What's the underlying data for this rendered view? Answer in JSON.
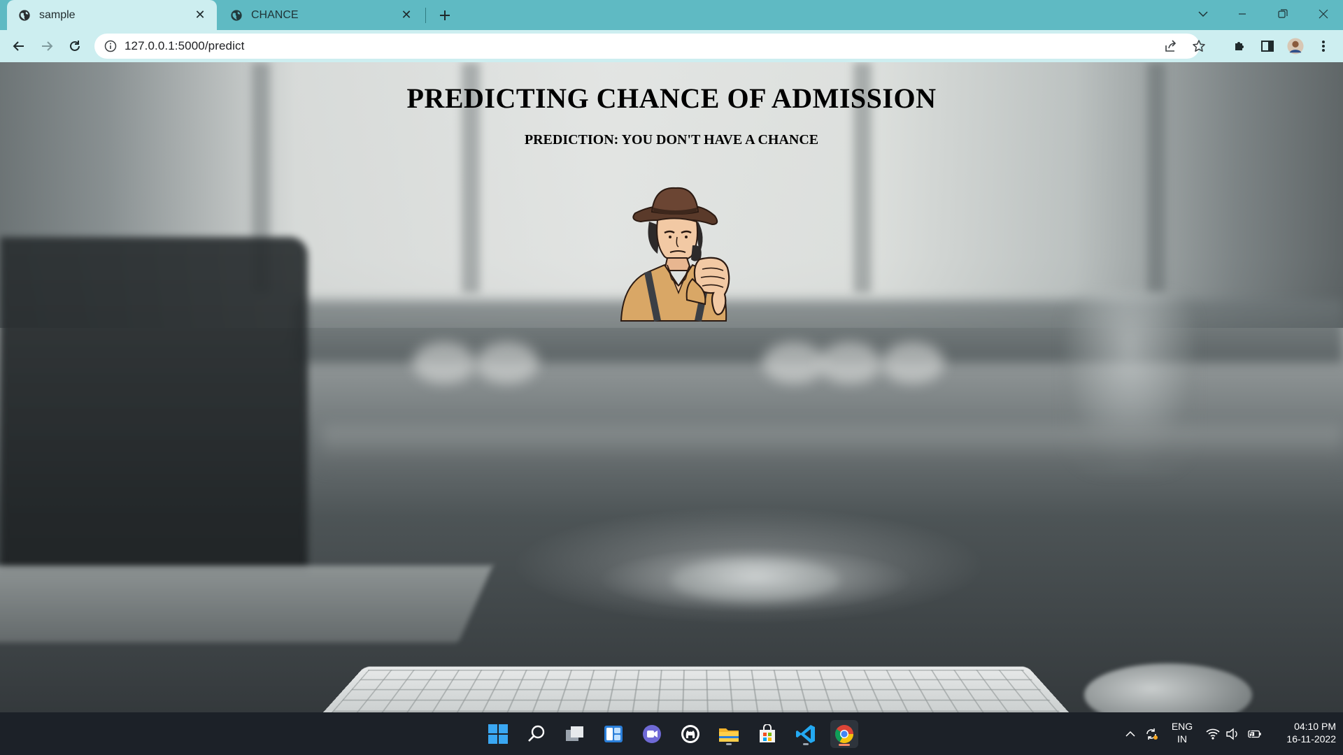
{
  "browser": {
    "tabs": [
      {
        "title": "sample",
        "active": true
      },
      {
        "title": "CHANCE",
        "active": false
      }
    ],
    "url": "127.0.0.1:5000/predict",
    "icons": [
      "globe-icon",
      "close-icon",
      "plus-icon",
      "back-arrow-icon",
      "forward-arrow-icon",
      "reload-icon",
      "info-icon",
      "share-icon",
      "star-icon",
      "puzzle-icon",
      "side-panel-icon",
      "avatar",
      "kebab-menu-icon",
      "minimize-icon",
      "restore-icon",
      "tab-search-icon"
    ]
  },
  "page": {
    "title": "PREDICTING CHANCE OF ADMISSION",
    "prediction": "PREDICTION: YOU DON'T HAVE A CHANCE",
    "image": "cowboy-thumbs-down-illustration"
  },
  "taskbar": {
    "apps": [
      "windows-start-icon",
      "search-icon",
      "task-view-icon",
      "widgets-icon",
      "teams-chat-icon",
      "github-icon",
      "file-explorer-icon",
      "microsoft-store-icon",
      "vscode-icon",
      "chrome-icon"
    ],
    "language": "ENG",
    "region": "IN",
    "time": "04:10 PM",
    "date": "16-11-2022"
  },
  "colors": {
    "tabbar": "#5fbac3",
    "toolbar": "#cdeef0",
    "taskbar": "#1c2128"
  }
}
